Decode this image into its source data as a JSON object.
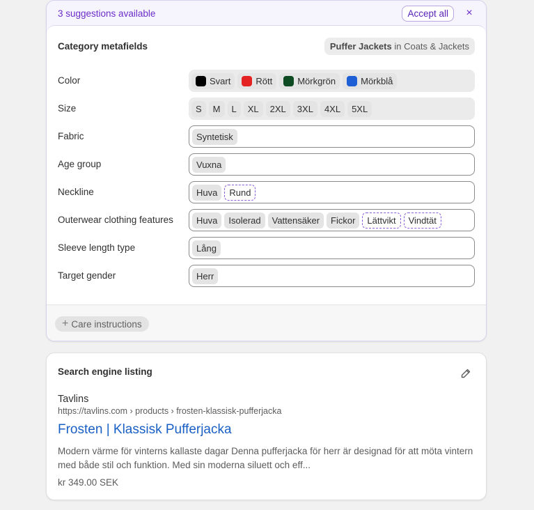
{
  "banner": {
    "suggestions_text": "3 suggestions available",
    "accept_all_label": "Accept all",
    "close_glyph": "×"
  },
  "metafields": {
    "title": "Category metafields",
    "category_name": "Puffer Jackets",
    "category_path": "in Coats & Jackets",
    "rows": [
      {
        "label": "Color",
        "chips": [
          {
            "text": "Svart",
            "swatch": "#000000"
          },
          {
            "text": "Rött",
            "swatch": "#e52222"
          },
          {
            "text": "Mörkgrön",
            "swatch": "#0e4a22"
          },
          {
            "text": "Mörkblå",
            "swatch": "#1f5fd6"
          }
        ]
      },
      {
        "label": "Size",
        "chips": [
          {
            "text": "S"
          },
          {
            "text": "M"
          },
          {
            "text": "L"
          },
          {
            "text": "XL"
          },
          {
            "text": "2XL"
          },
          {
            "text": "3XL"
          },
          {
            "text": "4XL"
          },
          {
            "text": "5XL"
          }
        ]
      },
      {
        "label": "Fabric",
        "chips": [
          {
            "text": "Syntetisk"
          }
        ]
      },
      {
        "label": "Age group",
        "chips": [
          {
            "text": "Vuxna"
          }
        ]
      },
      {
        "label": "Neckline",
        "chips": [
          {
            "text": "Huva"
          },
          {
            "text": "Rund",
            "suggested": true
          }
        ]
      },
      {
        "label": "Outerwear clothing features",
        "chips": [
          {
            "text": "Huva"
          },
          {
            "text": "Isolerad"
          },
          {
            "text": "Vattensäker"
          },
          {
            "text": "Fickor"
          },
          {
            "text": "Lättvikt",
            "suggested": true
          },
          {
            "text": "Vindtät",
            "suggested": true
          }
        ]
      },
      {
        "label": "Sleeve length type",
        "chips": [
          {
            "text": "Lång"
          }
        ]
      },
      {
        "label": "Target gender",
        "chips": [
          {
            "text": "Herr"
          }
        ]
      }
    ],
    "care_button_label": "Care instructions",
    "care_button_plus": "+"
  },
  "seo": {
    "title": "Search engine listing",
    "site_name": "Tavlins",
    "url": "https://tavlins.com › products › frosten-klassisk-pufferjacka",
    "page_title": "Frosten | Klassisk Pufferjacka",
    "description": "Modern värme för vinterns kallaste dagar Denna pufferjacka för herr är designad för att möta vintern med både stil och funktion. Med sin moderna siluett och eff...",
    "price": "kr 349.00 SEK"
  },
  "colors": {
    "accent_purple": "#6b2ec9",
    "link_blue": "#1a5fc4"
  }
}
